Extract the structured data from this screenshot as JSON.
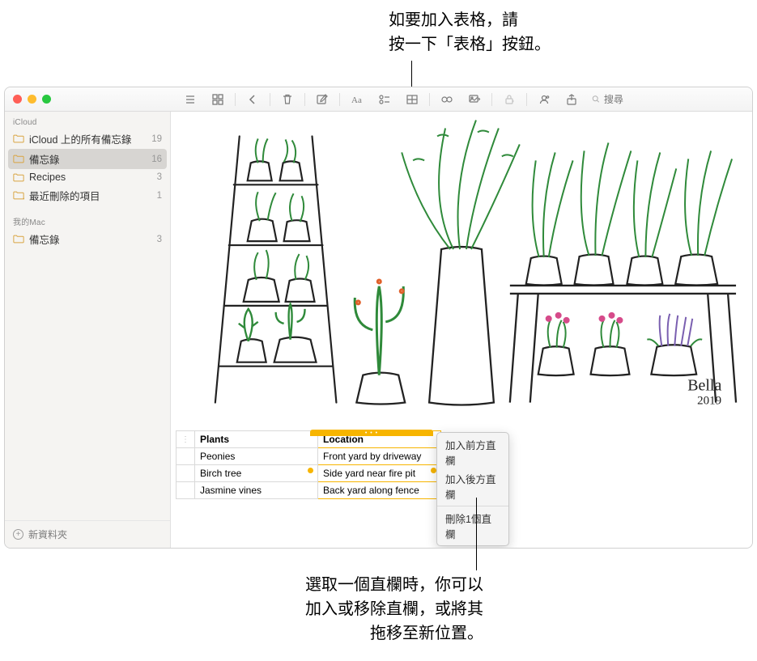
{
  "callouts": {
    "top": "如要加入表格，請\n按一下「表格」按鈕。",
    "bottom": "選取一個直欄時，你可以\n加入或移除直欄，或將其\n拖移至新位置。"
  },
  "sidebar": {
    "sections": [
      {
        "title": "iCloud"
      },
      {
        "title": "我的Mac"
      }
    ],
    "icloud_items": [
      {
        "label": "iCloud 上的所有備忘錄",
        "count": "19"
      },
      {
        "label": "備忘錄",
        "count": "16"
      },
      {
        "label": "Recipes",
        "count": "3"
      },
      {
        "label": "最近刪除的項目",
        "count": "1"
      }
    ],
    "mac_items": [
      {
        "label": "備忘錄",
        "count": "3"
      }
    ],
    "new_folder": "新資料夾"
  },
  "toolbar": {
    "search_placeholder": "搜尋"
  },
  "table": {
    "headers": [
      "Plants",
      "Location"
    ],
    "rows": [
      [
        "Peonies",
        "Front yard by driveway"
      ],
      [
        "Birch tree",
        "Side yard near fire pit"
      ],
      [
        "Jasmine vines",
        "Back yard along fence"
      ]
    ]
  },
  "context_menu": {
    "items": [
      "加入前方直欄",
      "加入後方直欄",
      "刪除1個直欄"
    ]
  },
  "drawing": {
    "signature": "Bella",
    "year": "2019"
  },
  "chart_data": {
    "type": "table",
    "headers": [
      "Plants",
      "Location"
    ],
    "rows": [
      [
        "Peonies",
        "Front yard by driveway"
      ],
      [
        "Birch tree",
        "Side yard near fire pit"
      ],
      [
        "Jasmine vines",
        "Back yard along fence"
      ]
    ]
  }
}
